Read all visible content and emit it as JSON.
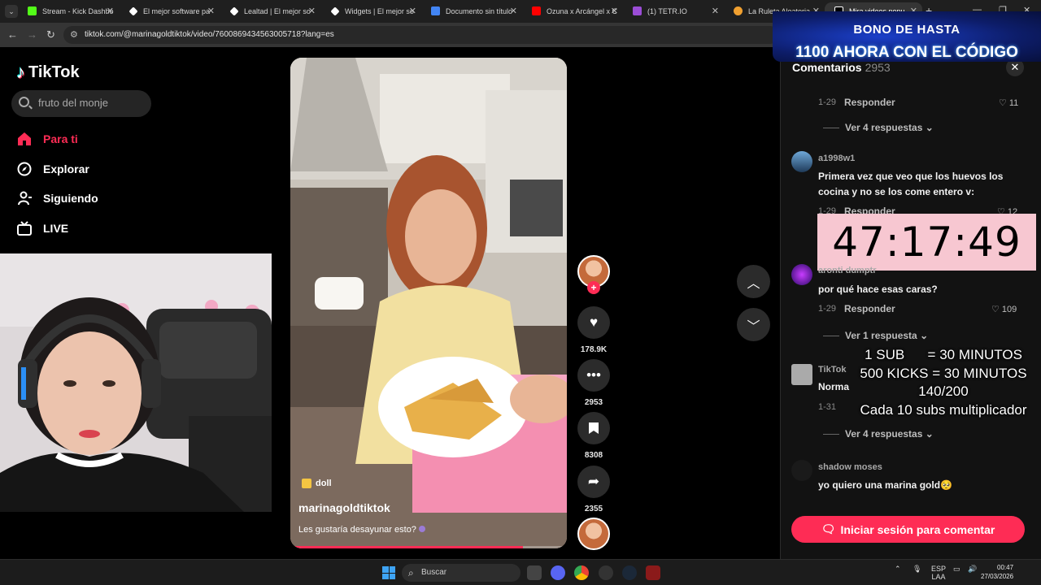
{
  "browser": {
    "tabs": [
      {
        "label": "Stream - Kick Dashbo",
        "favicon_color": "#53fc18"
      },
      {
        "label": "El mejor software pa",
        "favicon_color": "#ffffff"
      },
      {
        "label": "Lealtad | El mejor so",
        "favicon_color": "#ffffff"
      },
      {
        "label": "Widgets | El mejor so",
        "favicon_color": "#ffffff"
      },
      {
        "label": "Documento sin título",
        "favicon_color": "#4285f4"
      },
      {
        "label": "Ozuna x Arcángel x C",
        "favicon_color": "#ff0000"
      },
      {
        "label": "(1) TETR.IO",
        "favicon_color": "#9b4dd6"
      },
      {
        "label": "La Ruleta Aleatoria",
        "favicon_color": "#f0a030"
      },
      {
        "label": "Mira videos popu",
        "favicon_color": "#ffffff"
      }
    ],
    "url": "tiktok.com/@marinagoldtiktok/video/7600869434563005718?lang=es"
  },
  "tiktok": {
    "logo_text": "TikTok",
    "search": {
      "placeholder": "fruto del monje"
    },
    "nav": [
      {
        "label": "Para ti",
        "icon": "home-icon"
      },
      {
        "label": "Explorar",
        "icon": "compass-icon"
      },
      {
        "label": "Siguiendo",
        "icon": "user-icon"
      },
      {
        "label": "LIVE",
        "icon": "live-tv-icon"
      }
    ],
    "accent_color": "#fe2c55"
  },
  "video": {
    "tag": "doll",
    "author": "marinagoldtiktok",
    "description": "Les gustaría desayunar esto?",
    "progress_fraction": 0.84,
    "stats": {
      "likes": "178.9K",
      "comments": "2953",
      "saves": "8308",
      "shares": "2355"
    }
  },
  "overlay": {
    "promo_line1": "BONO DE HASTA",
    "promo_line2": "1100 AHORA CON EL CÓDIGO",
    "timer": "47:17:49",
    "subs_info": [
      "1 SUB      = 30 MINUTOS",
      "500 KICKS = 30 MINUTOS",
      "140/200",
      "Cada 10 subs multiplicador"
    ]
  },
  "comments": {
    "title": "Comentarios",
    "count": "2953",
    "reply_label": "Responder",
    "items": [
      {
        "date": "1-29",
        "likes": "11",
        "more": "Ver 4 respuestas"
      },
      {
        "user": "a1998w1",
        "text": "Primera vez que veo que los huevos los cocina y no se los come entero v:",
        "date": "1-29",
        "likes": "12"
      },
      {
        "user": "aronti dumptr",
        "text": "por qué hace esas caras?",
        "date": "1-29",
        "likes": "109",
        "more": "Ver 1 respuesta"
      },
      {
        "user": "TikTok",
        "text": "Norma",
        "date": "1-31",
        "more": "Ver 4 respuestas"
      },
      {
        "user": "shadow moses",
        "text": "yo quiero una marina gold🥺"
      }
    ],
    "login_label": "Iniciar sesión para comentar"
  },
  "taskbar": {
    "search_placeholder": "Buscar",
    "lang": "ESP",
    "lang_sub": "LAA",
    "time": "00:47",
    "date": "27/03/2026"
  }
}
